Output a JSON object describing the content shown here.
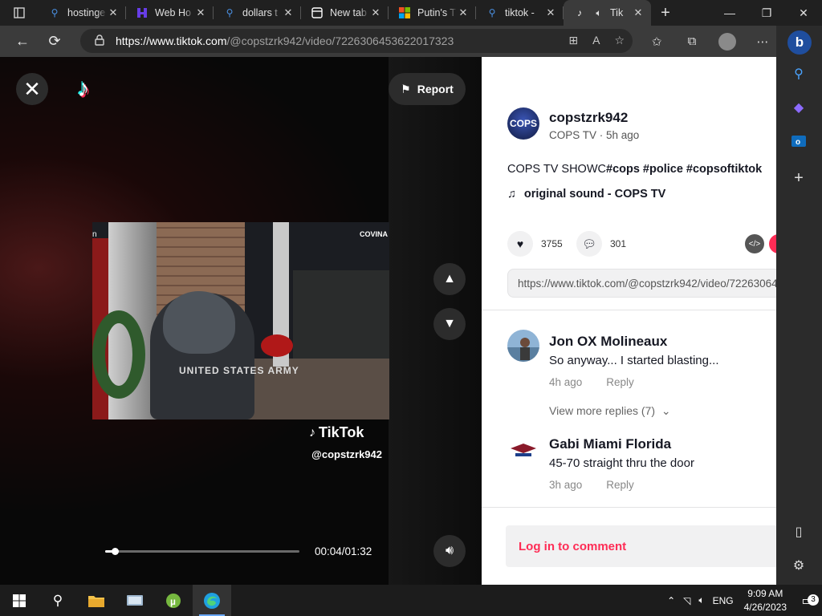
{
  "browser": {
    "tabs": [
      {
        "title": "hostinge",
        "favicon": "search-icon",
        "color": "#4a90e2"
      },
      {
        "title": "Web Ho",
        "favicon": "hostinger-icon",
        "color": "#673de6"
      },
      {
        "title": "dollars t",
        "favicon": "search-icon",
        "color": "#4a90e2"
      },
      {
        "title": "New tab",
        "favicon": "newtab-icon",
        "color": "#ffffff"
      },
      {
        "title": "Putin's T",
        "favicon": "microsoft-icon",
        "color": "#f25022"
      },
      {
        "title": "tiktok -",
        "favicon": "search-icon",
        "color": "#4a90e2"
      },
      {
        "title": "Tik",
        "favicon": "tiktok-icon",
        "color": "#ffffff",
        "active": true
      }
    ],
    "url_host": "https://www.tiktok.com",
    "url_path": "/@copstzrk942/video/7226306453622017323"
  },
  "video": {
    "report_label": "Report",
    "watermark_brand": "TikTok",
    "watermark_handle": "@copstzrk942",
    "frame_labels": {
      "left_edge": "n",
      "top_right": "COVINA",
      "shirt": "UNITED STATES ARMY"
    },
    "time": "00:04/01:32",
    "progress": 0.05
  },
  "info": {
    "author_name": "copstzrk942",
    "author_avatar_text": "COPS",
    "author_sub": "COPS TV · 5h ago",
    "desc_plain": "COPS TV SHOWC",
    "desc_tags": "#cops #police #copsoftiktok",
    "sound": "original sound - COPS TV",
    "likes": "3755",
    "comments_count": "301",
    "link": "https://www.tiktok.com/@copstzrk942/video/7226306453622017323"
  },
  "comments": [
    {
      "name": "Jon OX Molineaux",
      "text": "So anyway... I started blasting...",
      "time": "4h ago",
      "reply": "Reply"
    },
    {
      "name": "Gabi Miami Florida",
      "text": "45-70 straight thru the door",
      "time": "3h ago",
      "reply": "Reply"
    }
  ],
  "view_replies": "View more replies (7)",
  "login_label": "Log in to comment",
  "taskbar": {
    "lang": "ENG",
    "time": "9:09 AM",
    "date": "4/26/2023",
    "notifications": "3"
  },
  "colors": {
    "tiktok_red": "#fe2c55",
    "tiktok_cyan": "#25f4ee",
    "edge_blue": "#1f4e9e"
  }
}
